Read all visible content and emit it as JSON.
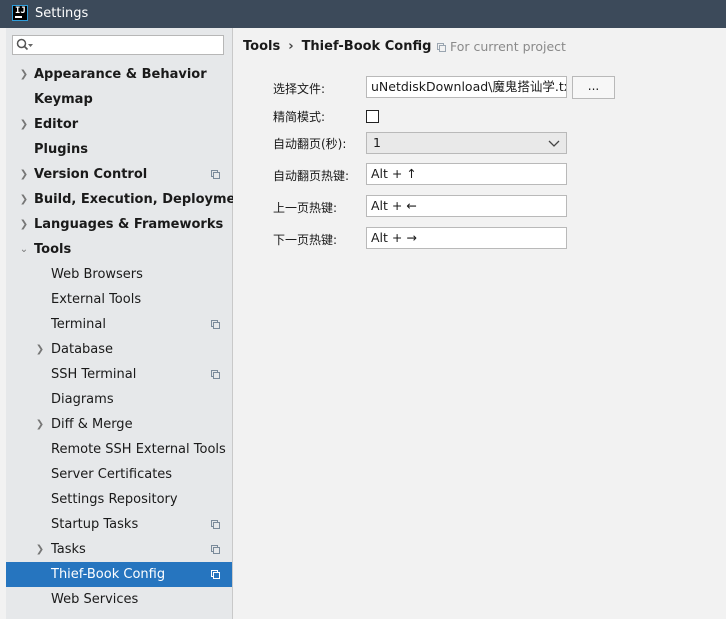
{
  "window": {
    "title": "Settings"
  },
  "search": {
    "value": "",
    "placeholder": ""
  },
  "sidebar": {
    "items": [
      {
        "label": "Appearance & Behavior"
      },
      {
        "label": "Keymap"
      },
      {
        "label": "Editor"
      },
      {
        "label": "Plugins"
      },
      {
        "label": "Version Control"
      },
      {
        "label": "Build, Execution, Deployment"
      },
      {
        "label": "Languages & Frameworks"
      },
      {
        "label": "Tools"
      },
      {
        "label": "Web Browsers"
      },
      {
        "label": "External Tools"
      },
      {
        "label": "Terminal"
      },
      {
        "label": "Database"
      },
      {
        "label": "SSH Terminal"
      },
      {
        "label": "Diagrams"
      },
      {
        "label": "Diff & Merge"
      },
      {
        "label": "Remote SSH External Tools"
      },
      {
        "label": "Server Certificates"
      },
      {
        "label": "Settings Repository"
      },
      {
        "label": "Startup Tasks"
      },
      {
        "label": "Tasks"
      },
      {
        "label": "Thief-Book Config"
      },
      {
        "label": "Web Services"
      }
    ]
  },
  "breadcrumb": {
    "parent": "Tools",
    "separator": "›",
    "current": "Thief-Book Config"
  },
  "scope": {
    "label": "For current project"
  },
  "form": {
    "file_label": "选择文件:",
    "file_value": "uNetdiskDownload\\魔鬼搭讪学.txt",
    "browse_label": "...",
    "simple_mode_label": "精简模式:",
    "simple_mode_checked": false,
    "auto_page_label": "自动翻页(秒):",
    "auto_page_value": "1",
    "auto_hotkey_label": "自动翻页热键:",
    "auto_hotkey_value": "Alt + ↑",
    "prev_hotkey_label": "上一页热键:",
    "prev_hotkey_value": "Alt + ←",
    "next_hotkey_label": "下一页热键:",
    "next_hotkey_value": "Alt + →"
  },
  "colors": {
    "selection": "#2675bf",
    "titlebar": "#3c4a5a",
    "sidebar": "#e6e8ea"
  }
}
